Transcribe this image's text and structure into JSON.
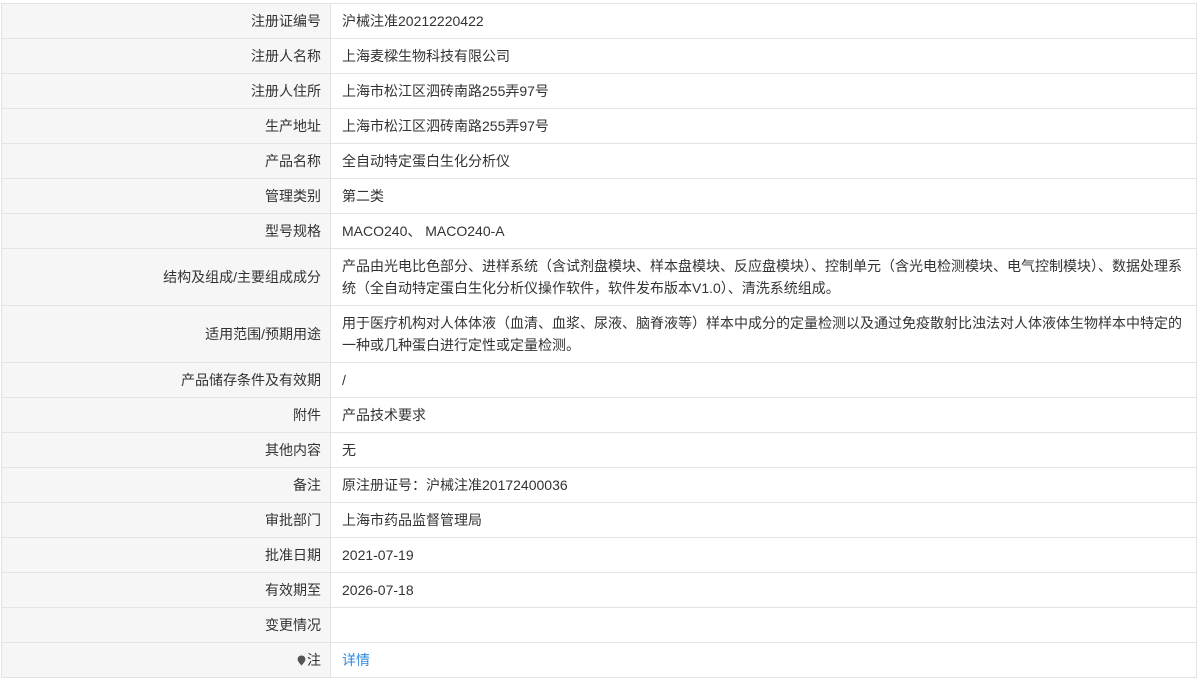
{
  "table": {
    "rows": [
      {
        "label": "注册证编号",
        "value": "沪械注准20212220422"
      },
      {
        "label": "注册人名称",
        "value": "上海麦樑生物科技有限公司"
      },
      {
        "label": "注册人住所",
        "value": "上海市松江区泗砖南路255弄97号"
      },
      {
        "label": "生产地址",
        "value": "上海市松江区泗砖南路255弄97号"
      },
      {
        "label": "产品名称",
        "value": "全自动特定蛋白生化分析仪"
      },
      {
        "label": "管理类别",
        "value": "第二类"
      },
      {
        "label": "型号规格",
        "value": "MACO240、 MACO240-A"
      },
      {
        "label": "结构及组成/主要组成成分",
        "value": "产品由光电比色部分、进样系统（含试剂盘模块、样本盘模块、反应盘模块）、控制单元（含光电检测模块、电气控制模块）、数据处理系统（全自动特定蛋白生化分析仪操作软件，软件发布版本V1.0）、清洗系统组成。"
      },
      {
        "label": "适用范围/预期用途",
        "value": "用于医疗机构对人体体液（血清、血浆、尿液、脑脊液等）样本中成分的定量检测以及通过免疫散射比浊法对人体液体生物样本中特定的一种或几种蛋白进行定性或定量检测。"
      },
      {
        "label": "产品储存条件及有效期",
        "value": "/"
      },
      {
        "label": "附件",
        "value": "产品技术要求"
      },
      {
        "label": "其他内容",
        "value": "无"
      },
      {
        "label": "备注",
        "value": "原注册证号：沪械注准20172400036"
      },
      {
        "label": "审批部门",
        "value": "上海市药品监督管理局"
      },
      {
        "label": "批准日期",
        "value": "2021-07-19"
      },
      {
        "label": "有效期至",
        "value": "2026-07-18"
      },
      {
        "label": "变更情况",
        "value": ""
      }
    ],
    "note_row": {
      "icon": "pin-icon",
      "label": "注",
      "link_text": "详情"
    }
  },
  "colors": {
    "label_background": "#f6f6f6",
    "border": "#e3e3e3",
    "text": "#333333",
    "link": "#2f8ae0"
  }
}
